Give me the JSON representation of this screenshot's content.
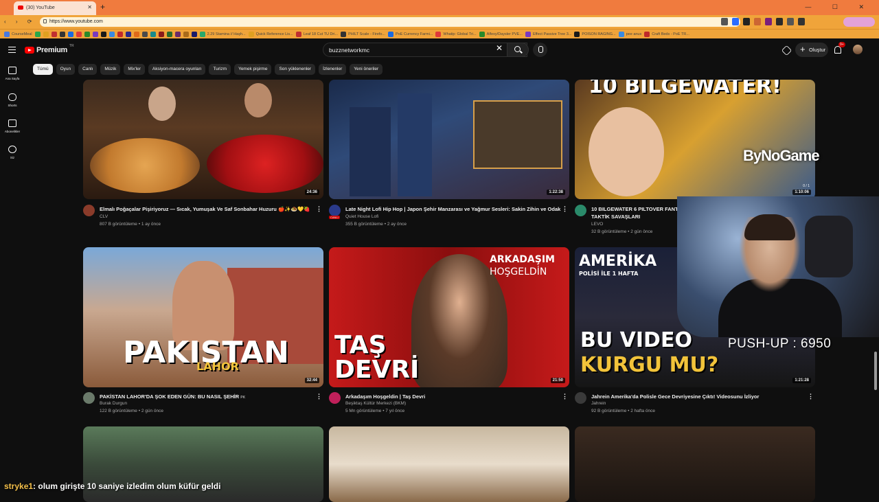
{
  "browser": {
    "tab_title": "(30) YouTube",
    "new_tab": "+",
    "window_buttons": "— ☐ ✕",
    "nav_buttons": "‹ › ⟳ ⌂",
    "url": "https://www.youtube.com",
    "bookmarks": [
      "CourseMeal",
      "",
      "",
      "",
      "",
      "",
      "",
      "",
      "",
      "",
      "",
      "",
      "",
      "",
      "",
      "",
      "",
      "",
      "",
      "",
      "",
      "2.29 Stamina // Haşh...",
      "Quick Reference Lis...",
      "Leaf 18 Cut TU Dri...",
      "PHILT Scale - Firefo...",
      "PoE Currency Farmi...",
      "Whatip: Global Tri...",
      "Alfexy/Daysler PVE...",
      "Effect Passive Tree 3...",
      "POISON RAGING...",
      "pee anus",
      "Craft Beds - PoE TR..."
    ]
  },
  "header": {
    "logo_text": "Premium",
    "logo_region": "TR",
    "search_query": "buzznetworkmc",
    "search_clear": "✕",
    "create_label": "Oluştur",
    "create_plus": "+",
    "bell_badge": "9+"
  },
  "sidebar": [
    {
      "label": "Ana Sayfa",
      "icon": "home-icon"
    },
    {
      "label": "Shorts",
      "icon": "shorts-icon"
    },
    {
      "label": "Abonelikler",
      "icon": "subscriptions-icon"
    },
    {
      "label": "Siz",
      "icon": "you-icon"
    }
  ],
  "chips": [
    "Tümü",
    "Oyun",
    "Canlı",
    "Müzik",
    "Mix'ler",
    "Aksiyon-macera oyunları",
    "Turizm",
    "Yemek pişirme",
    "Son yüklenenler",
    "İzlenenler",
    "Yeni öneriler"
  ],
  "videos": [
    {
      "title": "Elmalı Poğaçalar Pişiriyoruz — Sıcak, Yumuşak Ve Saf Sonbahar Huzuru 🍎✨🧆💛🍓",
      "channel": "CLV",
      "meta": "807 B görüntüleme • 1 ay önce",
      "duration": "24:36"
    },
    {
      "title": "Late Night Lofi Hip Hop | Japon Şehir Manzarası ve Yağmur Sesleri: Sakin Zihin ve Odak",
      "channel": "Quiet House Lofi",
      "meta": "355 B görüntüleme • 2 ay önce",
      "duration": "1:22:38",
      "live_badge": "CANLI"
    },
    {
      "title": "10 BILGEWATER 6 PILTOVER FANTEZİ TAKTİK SAVAŞLARI",
      "channel": "LEVO",
      "meta": "32 B görüntüleme • 2 gün önce",
      "duration": "1:10:06",
      "thumb_text": "10 BILGEWATER!",
      "counter": "0 / 1"
    },
    {
      "title": "PAKİSTAN LAHOR'DA ŞOK EDEN GÜN: BU NASIL ŞEHİR",
      "title_flag": "PK",
      "channel": "Burak Durgun",
      "meta": "122 B görüntüleme • 2 gün önce",
      "duration": "32:44",
      "thumb_text": "PAKISTAN",
      "thumb_sub": "LAHOR"
    },
    {
      "title": "Arkadaşım Hoşgeldin | Taş Devri",
      "channel": "Beşiktaş Kültür Merkezi (BKM)",
      "meta": "5 Mn görüntüleme • 7 yıl önce",
      "duration": "21:50",
      "thumb_text": "TAŞ",
      "thumb_text2": "DEVRİ",
      "thumb_top": "ARKADAŞIM",
      "thumb_top2": "HOŞGELDİN"
    },
    {
      "title": "Jahrein Amerika'da Polisle Gece Devriyesine Çıktı! Videosunu İzliyor",
      "channel": "Jahrein",
      "meta": "92 B görüntüleme • 2 hafta önce",
      "duration": "1:21:28",
      "thumb_text": "BU VIDEO",
      "thumb_text2": "KURGU MU?",
      "thumb_top": "AMERİKA",
      "thumb_top2": "POLİSİ İLE 1 HAFTA"
    }
  ],
  "overlays": {
    "watermark": "ByNoGame",
    "pushup_counter": "PUSH-UP : 6950",
    "chat_user": "stryke1",
    "chat_message": ": olum girişte 10 saniye izledim olum küfür geldi"
  },
  "colors": {
    "accent": "#ff0000",
    "browser_orange": "#f07b3e",
    "background": "#0f0f0f"
  }
}
